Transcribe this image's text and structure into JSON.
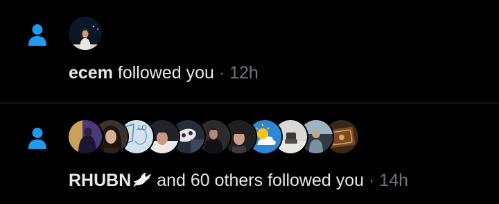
{
  "colors": {
    "background": "#000000",
    "accent": "#1d9bf0",
    "text": "#e7e9ea",
    "muted": "#71767b",
    "divider": "#2f3336"
  },
  "notifications": [
    {
      "icon": "person-icon",
      "name": "ecem",
      "action": "followed you",
      "separator": "·",
      "time": "12h",
      "avatars": [
        "avatar-ecem"
      ]
    },
    {
      "icon": "person-icon",
      "name": "RHUBN",
      "name_emoji": "dove-icon",
      "action": "and 60 others followed you",
      "separator": "·",
      "time": "14h",
      "avatars": [
        "avatar-rhubn",
        "avatar-2",
        "avatar-3",
        "avatar-4",
        "avatar-5",
        "avatar-6",
        "avatar-7",
        "avatar-weather",
        "avatar-9",
        "avatar-book"
      ]
    }
  ]
}
